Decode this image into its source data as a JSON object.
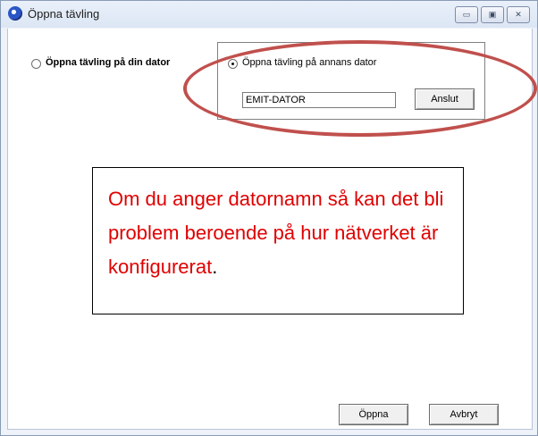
{
  "window": {
    "title": "Öppna tävling",
    "icon": "app-globe-icon"
  },
  "titlebar_buttons": {
    "minimize_glyph": "▭",
    "maximize_glyph": "▣",
    "close_glyph": "✕"
  },
  "options": {
    "local": {
      "label": "Öppna tävling på din dator",
      "selected": false
    },
    "remote": {
      "label": "Öppna tävling på annans dator",
      "selected": true
    }
  },
  "remote": {
    "computer_name": "EMIT-DATOR",
    "connect_label": "Anslut"
  },
  "footer": {
    "open_label": "Öppna",
    "cancel_label": "Avbryt"
  },
  "annotation": {
    "text": "Om du anger datornamn så kan det bli problem beroende på hur nätverket är konfigurerat",
    "period": ".",
    "text_color": "#e00000",
    "ellipse_color": "#c0504d"
  }
}
